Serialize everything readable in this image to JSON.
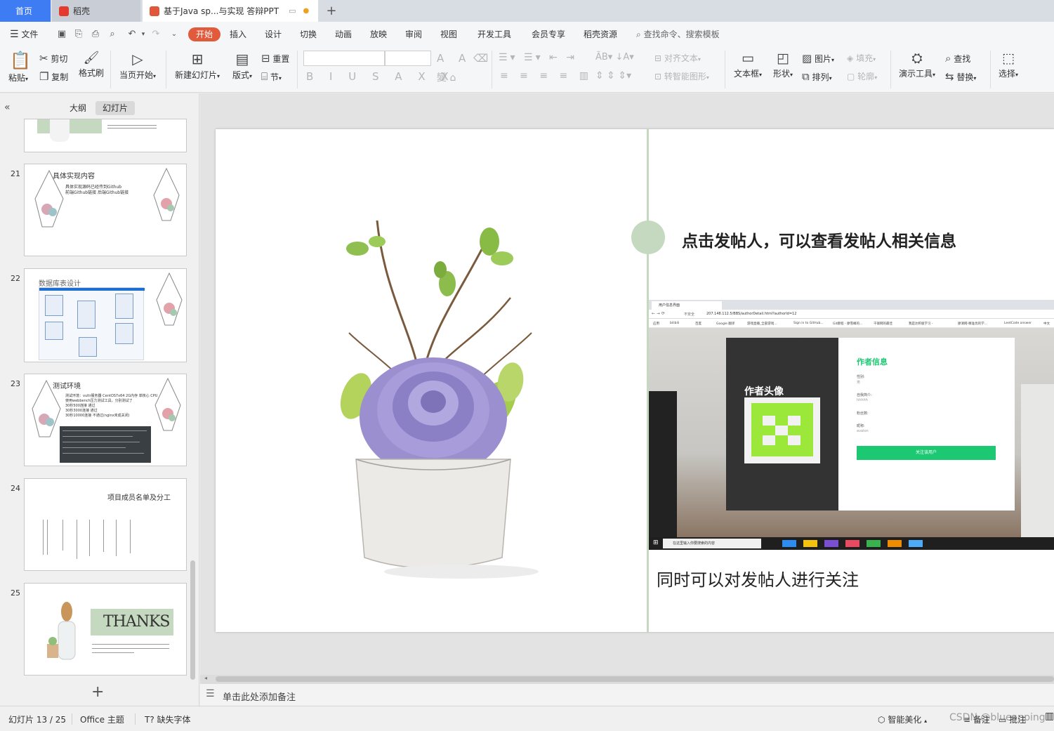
{
  "tabs": {
    "home": "首页",
    "docer": "稻壳",
    "document": "基于Java sp...与实现 答辩PPT"
  },
  "menu": {
    "file": "文件",
    "items": [
      "开始",
      "插入",
      "设计",
      "切换",
      "动画",
      "放映",
      "审阅",
      "视图",
      "开发工具",
      "会员专享",
      "稻壳资源"
    ],
    "search_placeholder": "查找命令、搜索模板"
  },
  "ribbon": {
    "paste": "粘贴",
    "cut": "剪切",
    "copy": "复制",
    "format_painter": "格式刷",
    "from_current": "当页开始",
    "new_slide": "新建幻灯片",
    "layout": "版式",
    "reset": "重置",
    "section": "节",
    "align_text": "对齐文本",
    "smart_shape": "转智能图形",
    "text_box": "文本框",
    "shape": "形状",
    "picture": "图片",
    "fill": "填充",
    "arrange": "排列",
    "outline": "轮廓",
    "presentation_tools": "演示工具",
    "find": "查找",
    "replace": "替换",
    "select": "选择"
  },
  "left_panel": {
    "tab_outline": "大纲",
    "tab_slides": "幻灯片",
    "slides": [
      {
        "num": "21",
        "title": "具体实现内容",
        "lines": [
          "具体实现源码已经传到Github",
          "前端Github链接  后端Github链接"
        ]
      },
      {
        "num": "22",
        "title": "数据库表设计"
      },
      {
        "num": "23",
        "title": "测试环境",
        "lines": [
          "测试环境：vultr服务器 CentOS7x64 2G内存 单核心 CPU",
          "使用webbench压力测试工具，分别测试了",
          "30秒500连接    通过",
          "30秒3000连接    通过",
          "30秒10000连接    不通过(nginx未成关闭)"
        ]
      },
      {
        "num": "24",
        "title": "项目成员名单及分工"
      },
      {
        "num": "25",
        "title": "THANKS"
      }
    ]
  },
  "slide": {
    "heading": "点击发帖人，可以查看发帖人相关信息",
    "caption": "同时可以对发帖人进行关注",
    "screenshot": {
      "tab_title": "用户信息界面",
      "insecure": "不安全",
      "url": "207.148.112.5/BBS/authorDetail.html?authorId=12",
      "bookmarks": [
        "应用",
        "bilibili",
        "百度",
        "Google 翻译",
        "游戏直播_全部游戏...",
        "Sign in to GitHub...",
        "Git教程 - 廖雪峰的...",
        "千锋网的最佳",
        "我是达积极学习 -",
        "廖清网-精准优的学...",
        "LeetCode answer",
        "中文"
      ],
      "avatar_title": "作者头像",
      "info_title": "作者信息",
      "fields": [
        {
          "label": "性别:",
          "value": "男"
        },
        {
          "label": "自我简介:",
          "value": "hhhhh"
        },
        {
          "label": "粉丝数:",
          "value": ""
        },
        {
          "label": "昵称:",
          "value": "avalon"
        }
      ],
      "follow_button": "关注该用户",
      "taskbar_search": "在这里输入你要搜索的内容"
    }
  },
  "notes_placeholder": "单击此处添加备注",
  "status": {
    "slide_count": "幻灯片 13 / 25",
    "theme": "Office 主题",
    "missing_font": "缺失字体",
    "beautify": "智能美化",
    "notes": "备注",
    "comments": "批注",
    "watermark": "CSDN @blueapping"
  },
  "colors": {
    "accent_blue": "#3e7cf3",
    "start_red": "#e05a3b",
    "slide_green": "#c4d9c0",
    "follow_green": "#1dc873",
    "avatar_green": "#9be83b"
  }
}
